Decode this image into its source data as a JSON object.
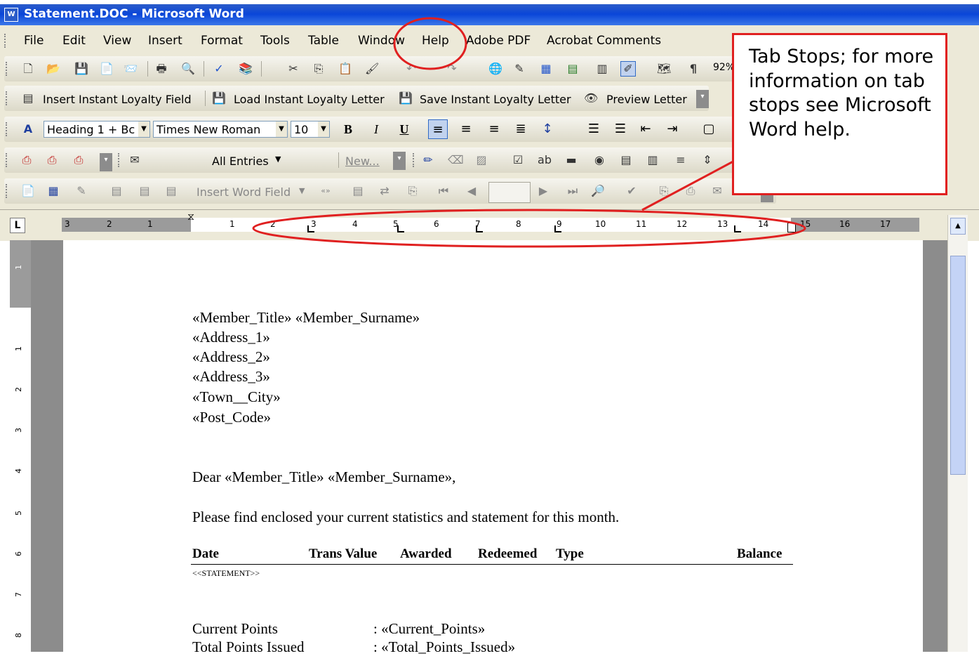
{
  "window": {
    "title": "Statement.DOC - Microsoft Word",
    "app_icon": "word-doc-icon"
  },
  "menu": [
    "File",
    "Edit",
    "View",
    "Insert",
    "Format",
    "Tools",
    "Table",
    "Window",
    "Help",
    "Adobe PDF",
    "Acrobat Comments"
  ],
  "standard_toolbar": {
    "zoom": "92%"
  },
  "loyalty_toolbar": {
    "insert_field": "Insert Instant Loyalty Field",
    "load_letter": "Load Instant Loyalty Letter",
    "save_letter": "Save Instant Loyalty Letter",
    "preview_letter": "Preview Letter"
  },
  "formatting_toolbar": {
    "style": "Heading 1 + Bc",
    "font": "Times New Roman",
    "size": "10"
  },
  "mail_merge": {
    "entries": "All Entries",
    "new": "New...",
    "insert_word_field": "Insert Word Field"
  },
  "ruler": {
    "labels": [
      "3",
      "2",
      "1",
      "1",
      "2",
      "3",
      "4",
      "5",
      "6",
      "7",
      "8",
      "9",
      "10",
      "11",
      "12",
      "13",
      "14",
      "15",
      "16",
      "17"
    ],
    "vertical_labels": [
      "1",
      "1",
      "2",
      "3",
      "4",
      "5",
      "6",
      "7",
      "8"
    ]
  },
  "document": {
    "address": [
      "«Member_Title» «Member_Surname»",
      "«Address_1»",
      "«Address_2»",
      "«Address_3»",
      "«Town__City»",
      "«Post_Code»"
    ],
    "greeting": "Dear «Member_Title» «Member_Surname»,",
    "intro": "Please find enclosed your current statistics and statement for this month.",
    "table_headers": {
      "date": "Date",
      "trans_value": "Trans Value",
      "awarded": "Awarded",
      "redeemed": "Redeemed",
      "type": "Type",
      "balance": "Balance"
    },
    "statement_field": "<<STATEMENT>>",
    "summary": [
      {
        "label": "Current Points",
        "value": ": «Current_Points»"
      },
      {
        "label": "Total Points Issued",
        "value": ": «Total_Points_Issued»"
      }
    ]
  },
  "callout": {
    "text": "Tab Stops; for more information on tab stops see Microsoft Word help."
  },
  "colors": {
    "annotation": "#e02020",
    "title_bar": "#0a46d8",
    "toolbar": "#ece9d8"
  }
}
